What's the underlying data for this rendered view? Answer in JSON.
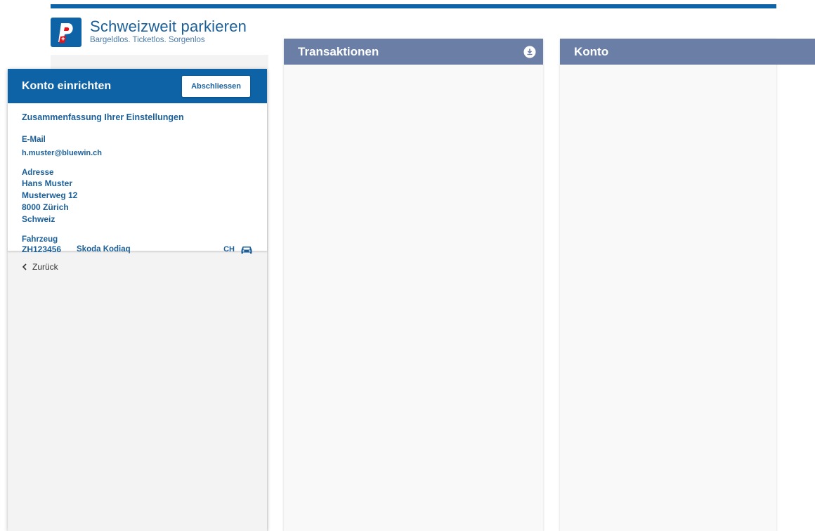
{
  "brand": {
    "title": "Schweizweit parkieren",
    "subtitle": "Bargeldlos. Ticketlos. Sorgenlos",
    "logo_icon": "parking-p-logo-icon",
    "color": "#0d63a5"
  },
  "setup": {
    "title": "Konto einrichten",
    "finish_label": "Abschliessen",
    "summary_title": "Zusammenfassung Ihrer Einstellungen",
    "email_label": "E-Mail",
    "email_value": "h.muster@bluewin.ch",
    "address_label": "Adresse",
    "address_lines": [
      "Hans Muster",
      "Musterweg 12",
      "8000 Zürich",
      "Schweiz"
    ],
    "vehicle_label": "Fahrzeug",
    "vehicle_plate": "ZH123456",
    "vehicle_model": "Skoda Kodiaq",
    "vehicle_country": "CH",
    "vehicle_icon": "car-icon",
    "back_label": "Zurück",
    "back_icon": "chevron-left-icon"
  },
  "transactions": {
    "title": "Transaktionen",
    "action_icon": "download-icon"
  },
  "account": {
    "title": "Konto"
  },
  "colors": {
    "primary": "#0d63a5",
    "panel_header": "#6b7fa6",
    "text_blue": "#1b5f99"
  }
}
